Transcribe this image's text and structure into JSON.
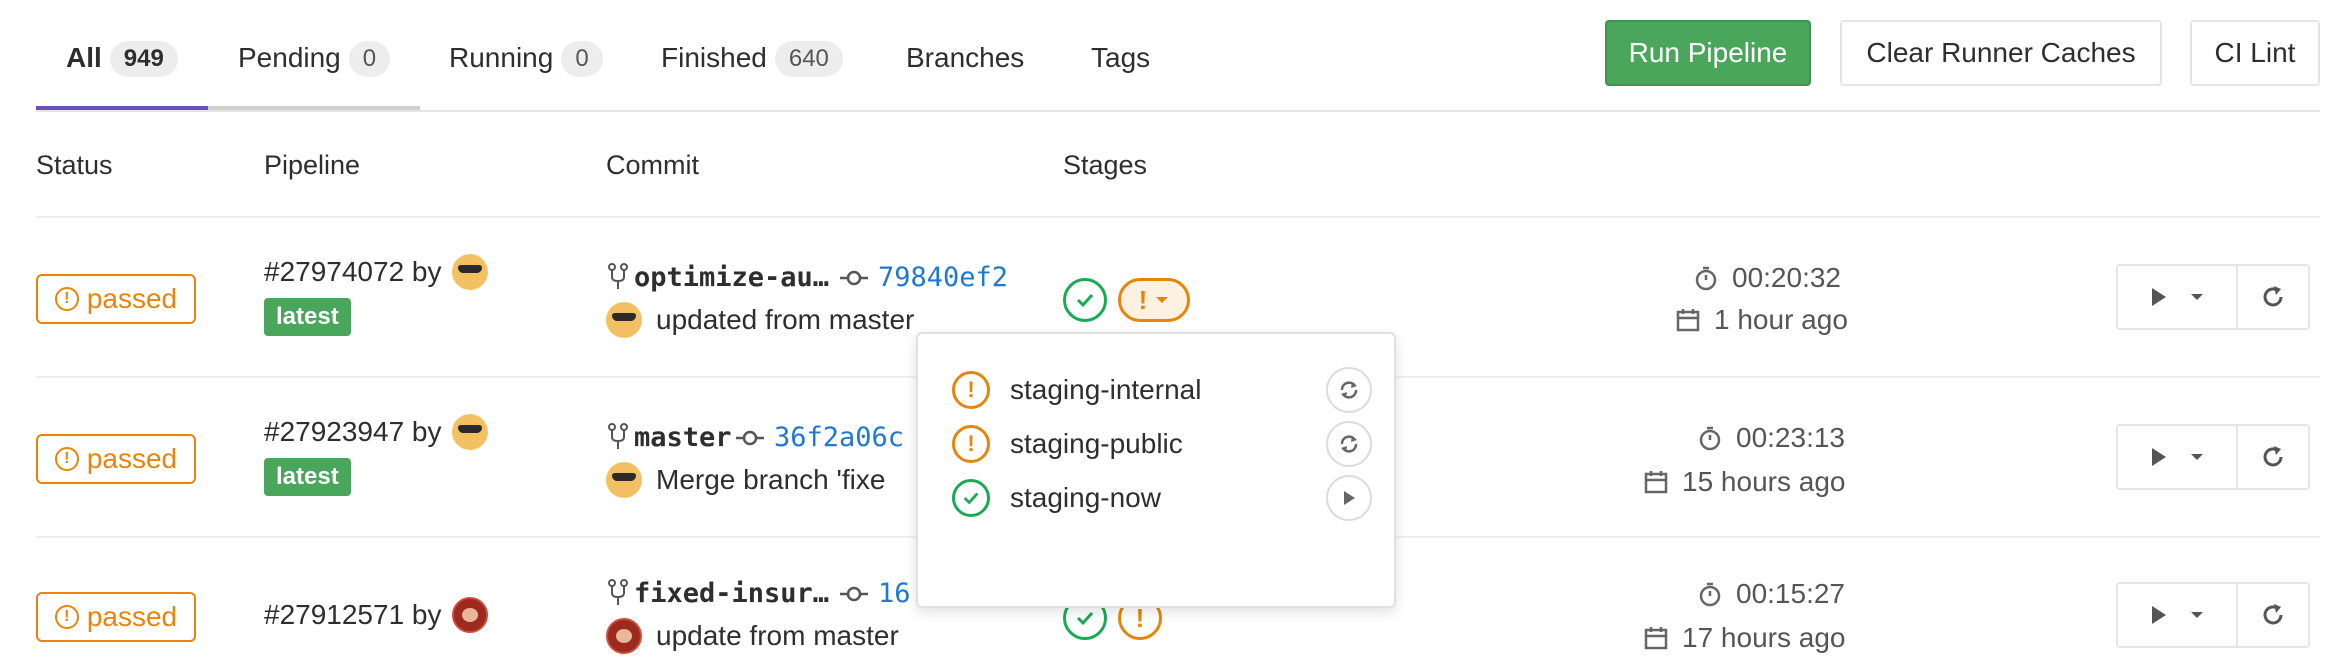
{
  "tabs": [
    {
      "label": "All",
      "count": "949"
    },
    {
      "label": "Pending",
      "count": "0"
    },
    {
      "label": "Running",
      "count": "0"
    },
    {
      "label": "Finished",
      "count": "640"
    },
    {
      "label": "Branches"
    },
    {
      "label": "Tags"
    }
  ],
  "buttons": {
    "run_pipeline": "Run Pipeline",
    "clear_caches": "Clear Runner Caches",
    "ci_lint": "CI Lint"
  },
  "columns": {
    "status": "Status",
    "pipeline": "Pipeline",
    "commit": "Commit",
    "stages": "Stages"
  },
  "pipelines": [
    {
      "status": "passed",
      "id": "#27974072 by",
      "tag": "latest",
      "ref": "optimize-au…",
      "sha": "79840ef2",
      "message": "updated from master",
      "duration": "00:20:32",
      "finished": "1 hour ago",
      "avatar": "yellow"
    },
    {
      "status": "passed",
      "id": "#27923947 by",
      "tag": "latest",
      "ref": "master",
      "sha": "36f2a06c",
      "message": "Merge branch 'fixe",
      "duration": "00:23:13",
      "finished": "15 hours ago",
      "avatar": "yellow"
    },
    {
      "status": "passed",
      "id": "#27912571 by",
      "ref": "fixed-insur…",
      "sha": "16",
      "message": "update from master",
      "duration": "00:15:27",
      "finished": "17 hours ago",
      "avatar": "red"
    }
  ],
  "stage_dropdown": {
    "jobs": [
      {
        "name": "staging-internal",
        "status": "warning",
        "action": "retry-icon"
      },
      {
        "name": "staging-public",
        "status": "warning",
        "action": "retry-icon"
      },
      {
        "name": "staging-now",
        "status": "success",
        "action": "play-icon"
      }
    ]
  },
  "colors": {
    "accent": "#6b4fbb",
    "success": "#1aaa55",
    "warning": "#e6850a",
    "primary_button": "#4aa65b",
    "link": "#1f78d1"
  }
}
